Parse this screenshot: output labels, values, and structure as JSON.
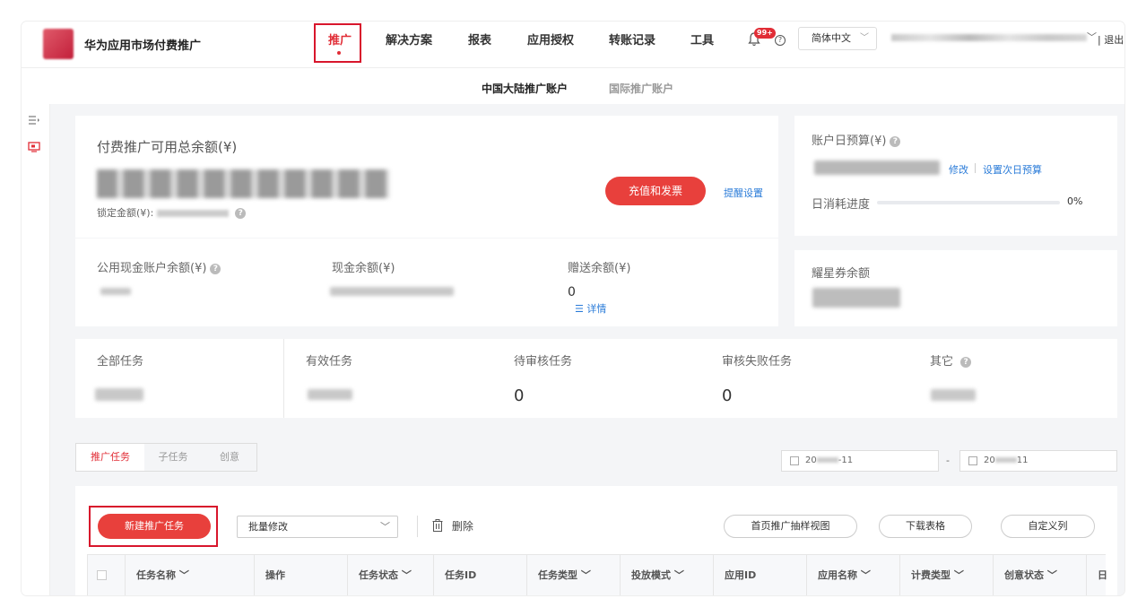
{
  "header": {
    "brand": "华为应用市场付费推广",
    "nav": [
      "推广",
      "解决方案",
      "报表",
      "应用授权",
      "转账记录",
      "工具"
    ],
    "notification_badge": "99+",
    "help_icon": "?",
    "language": "简体中文",
    "logout": "退出",
    "accent_color": "#e12d36"
  },
  "subtabs": [
    "中国大陆推广账户",
    "国际推广账户"
  ],
  "balance_card": {
    "title": "付费推广可用总余额(¥)",
    "locked_label": "锁定金额(¥):",
    "recharge_button": "充值和发票",
    "reminder_link": "提醒设置"
  },
  "sub_balances": {
    "public_cash_label": "公用现金账户余额(¥)",
    "cash_label": "现金余额(¥)",
    "gift_label": "赠送余额(¥)",
    "gift_value": "0",
    "details_link": "详情"
  },
  "budget_card": {
    "title": "账户日预算(¥)",
    "edit_link": "修改",
    "next_day_link": "设置次日预算",
    "progress_label": "日消耗进度",
    "progress_value": "0%",
    "progress_fraction": 0
  },
  "coupon_card": {
    "title": "耀星券余额"
  },
  "stats": {
    "all": "全部任务",
    "valid": "有效任务",
    "pending": "待审核任务",
    "pending_value": "0",
    "failed": "审核失败任务",
    "failed_value": "0",
    "other": "其它"
  },
  "task_tabs": [
    "推广任务",
    "子任务",
    "创意"
  ],
  "date_range": {
    "start_prefix": "20",
    "start_suffix": "-11",
    "separator": "-",
    "end_prefix": "20",
    "end_suffix": "11"
  },
  "toolbar": {
    "new_task": "新建推广任务",
    "batch_edit": "批量修改",
    "delete": "删除",
    "sample_view": "首页推广抽样视图",
    "download": "下载表格",
    "custom_columns": "自定义列"
  },
  "table_headers": [
    "任务名称 ﹀",
    "操作",
    "任务状态 ﹀",
    "任务ID",
    "任务类型 ﹀",
    "投放模式 ﹀",
    "应用ID",
    "应用名称 ﹀",
    "计费类型 ﹀",
    "创意状态 ﹀",
    "日"
  ]
}
